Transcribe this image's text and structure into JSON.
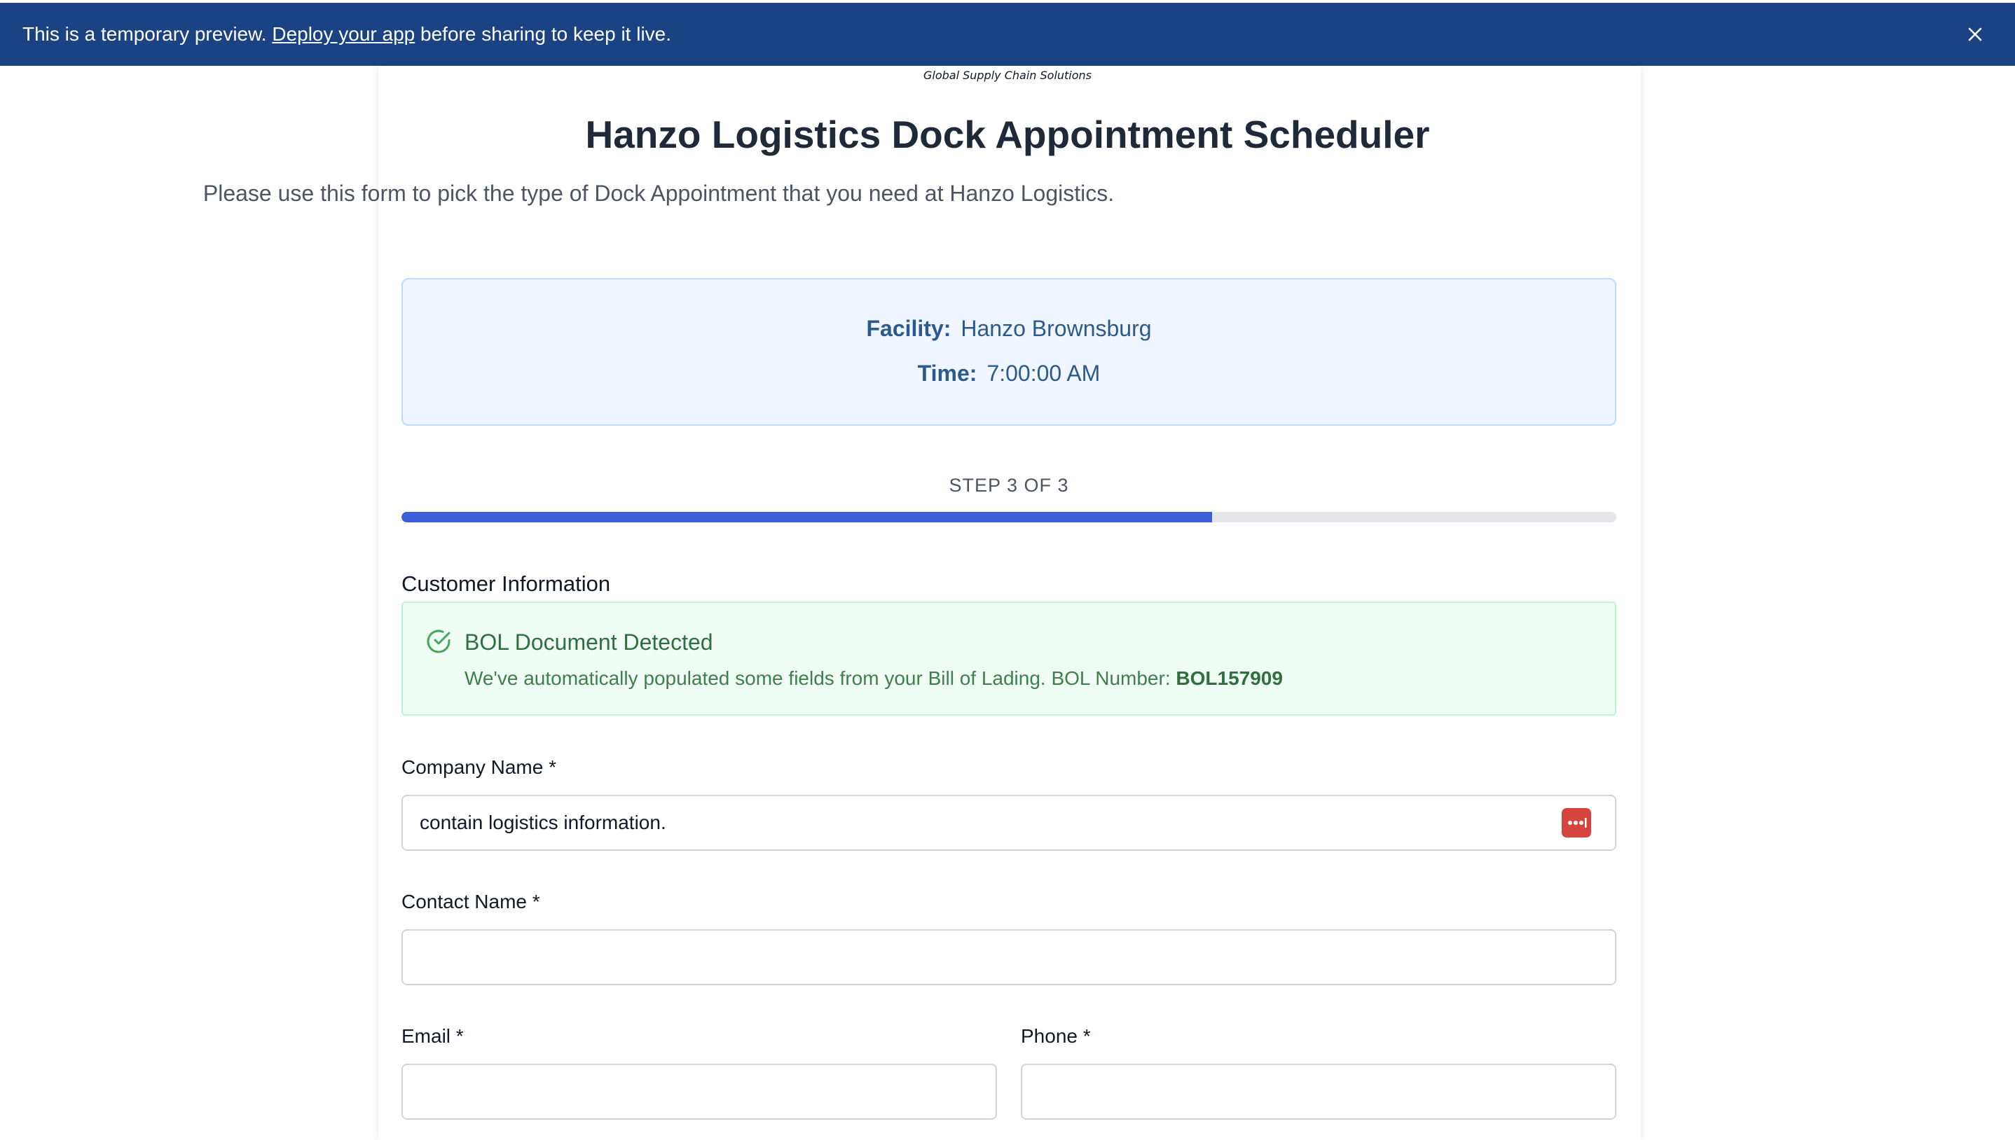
{
  "banner": {
    "text_before": "This is a temporary preview. ",
    "link_label": "Deploy your app",
    "text_after": " before sharing to keep it live.",
    "close_icon": "close-icon",
    "background": "#1b4282"
  },
  "header": {
    "tagline": "Global Supply Chain Solutions",
    "title": "Hanzo Logistics Dock Appointment Scheduler",
    "subtitle": "Please use this form to pick the type of Dock Appointment that you need at Hanzo Logistics."
  },
  "info": {
    "facility_label": "Facility:",
    "facility_value": "Hanzo Brownsburg",
    "time_label": "Time:",
    "time_value": "7:00:00 AM"
  },
  "progress": {
    "step_label": "STEP 3 OF 3",
    "fraction": 0.667,
    "fill_color": "#3b5fd9"
  },
  "section": {
    "title": "Customer Information"
  },
  "alert": {
    "icon": "check-circle-icon",
    "title": "BOL Document Detected",
    "body": "We've automatically populated some fields from your Bill of Lading. BOL Number: ",
    "bol_number": "BOL157909"
  },
  "form": {
    "company_label": "Company Name *",
    "company_value": "contain logistics information.",
    "contact_label": "Contact Name *",
    "contact_value": "",
    "email_label": "Email *",
    "email_value": "",
    "phone_label": "Phone *",
    "phone_value": "",
    "password_manager_icon": "password-manager-icon"
  }
}
